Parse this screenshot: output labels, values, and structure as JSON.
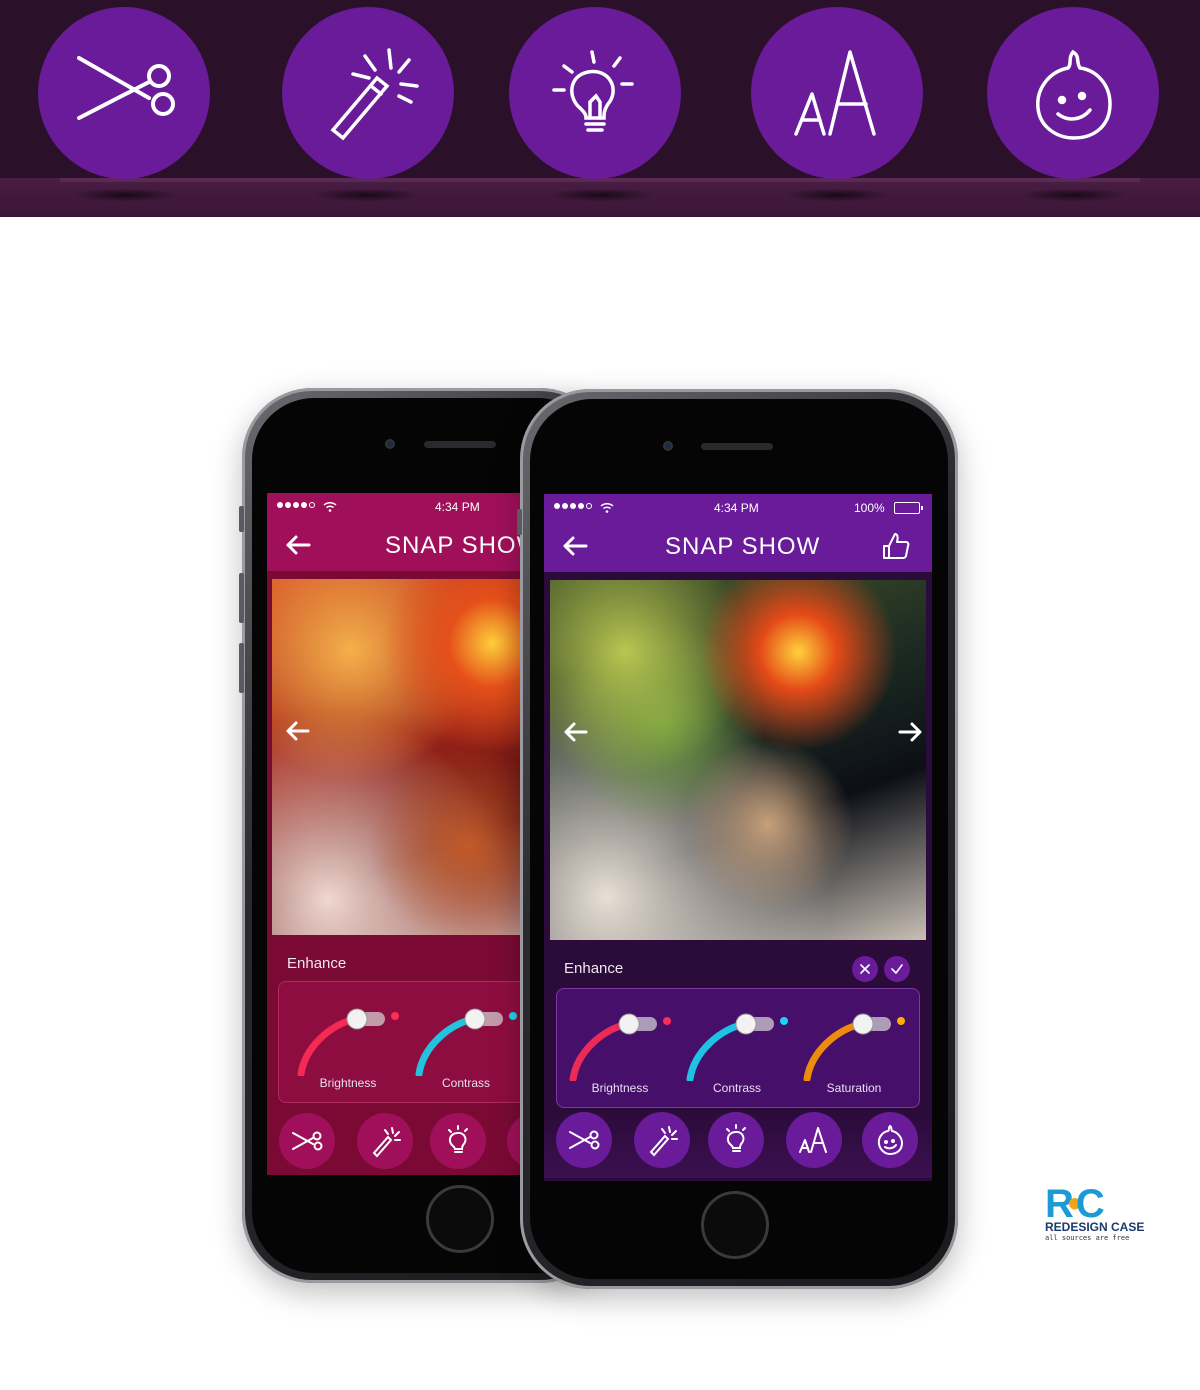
{
  "banner": {
    "icons": [
      "scissors-icon",
      "magic-wand-icon",
      "lightbulb-icon",
      "text-aa-icon",
      "face-drop-icon"
    ],
    "circle_color": "#6a1b9a"
  },
  "phone_back": {
    "theme_color": "#a0105a",
    "panel_color": "#7a0a34",
    "status": {
      "time": "4:34 PM"
    },
    "nav": {
      "title": "SNAP SHOW"
    },
    "panel": {
      "title": "Enhance",
      "sliders": [
        {
          "label": "Brightness",
          "color": "#ff2d55"
        },
        {
          "label": "Contrass",
          "color": "#1ad6f0"
        }
      ]
    }
  },
  "phone_front": {
    "theme_color": "#6a1b9a",
    "panel_color": "#2b0b3a",
    "status": {
      "time": "4:34 PM",
      "battery": "100%"
    },
    "nav": {
      "title": "SNAP SHOW"
    },
    "panel": {
      "title": "Enhance",
      "sliders": [
        {
          "label": "Brightness",
          "color": "#ff2d55"
        },
        {
          "label": "Contrass",
          "color": "#1ad6f0"
        },
        {
          "label": "Saturation",
          "color": "#ff9a00"
        }
      ]
    }
  },
  "logo": {
    "mark_left": "R",
    "mark_right": "C",
    "name": "REDESIGN CASE",
    "tagline": "all sources are free"
  }
}
